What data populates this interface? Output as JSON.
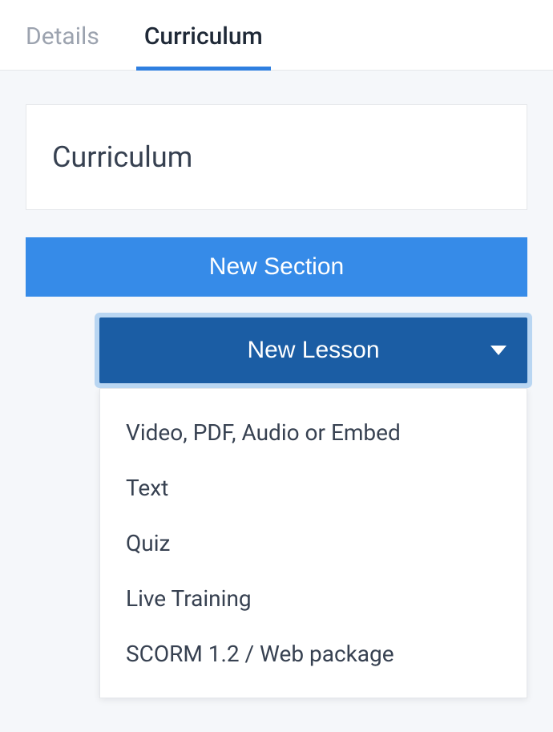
{
  "tabs": {
    "items": [
      {
        "label": "Details",
        "active": false
      },
      {
        "label": "Curriculum",
        "active": true
      }
    ]
  },
  "content": {
    "title": "Curriculum",
    "new_section_label": "New Section",
    "new_lesson_label": "New Lesson",
    "lesson_types": [
      "Video, PDF, Audio or Embed",
      "Text",
      "Quiz",
      "Live Training",
      "SCORM 1.2 / Web package"
    ]
  },
  "colors": {
    "primary": "#368be8",
    "primary_dark": "#1b5da4",
    "focus_ring": "#b9d6f2",
    "tab_inactive": "#9ca3af",
    "tab_active": "#1f2937",
    "text": "#374151"
  }
}
